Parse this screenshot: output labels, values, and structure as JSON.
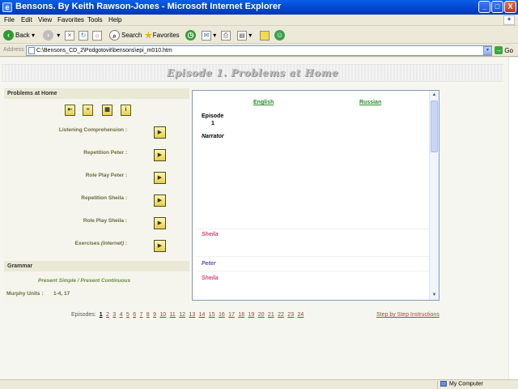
{
  "window": {
    "title": "Bensons. By Keith Rawson-Jones - Microsoft Internet Explorer",
    "icon": "ie-icon",
    "controls": {
      "minimize": "_",
      "maximize": "□",
      "close": "X"
    }
  },
  "menu": {
    "items": [
      "File",
      "Edit",
      "View",
      "Favorites",
      "Tools",
      "Help"
    ]
  },
  "toolbar": {
    "back": "Back",
    "search": "Search",
    "favorites": "Favorites"
  },
  "address": {
    "label": "Address",
    "url": "C:\\Bensons_CD_2\\Podgotovit\\bensons\\epi_m010.htm",
    "go": "Go"
  },
  "page": {
    "header": "Episode 1. Problems at Home",
    "problems": {
      "heading": "Problems at Home",
      "rows": [
        {
          "label": "Listening Comprehension :"
        },
        {
          "label": "Repetition Peter :"
        },
        {
          "label": "Role Play Peter :"
        },
        {
          "label": "Repetition Sheila :"
        },
        {
          "label": "Role Play Sheila :"
        },
        {
          "label": "Exercises",
          "label_em": "(Internet)",
          "label_tail": " :"
        }
      ]
    },
    "grammar": {
      "heading": "Grammar",
      "topic": "Present Simple / Present Continuous",
      "murphy_label": "Murphy Units :",
      "murphy_value": "1-4, 17"
    },
    "text_panel": {
      "english": "English",
      "russian": "Russian",
      "episode_label": "Episode",
      "episode_number": "1",
      "speakers": [
        {
          "name": "Narrator",
          "color": "#000000"
        },
        {
          "name": "Sheila",
          "color": "#D0487A"
        },
        {
          "name": "Peter",
          "color": "#5A4FC8"
        },
        {
          "name": "Sheila",
          "color": "#D0487A"
        }
      ]
    },
    "episodes": {
      "label": "Episodes:",
      "numbers": [
        "1",
        "2",
        "3",
        "4",
        "5",
        "6",
        "7",
        "8",
        "9",
        "10",
        "11",
        "12",
        "13",
        "14",
        "15",
        "16",
        "17",
        "18",
        "19",
        "20",
        "21",
        "22",
        "23",
        "24"
      ],
      "current": "1"
    },
    "instructions_link": "Step by Step Instructions"
  },
  "status": {
    "zone": "My Computer"
  }
}
